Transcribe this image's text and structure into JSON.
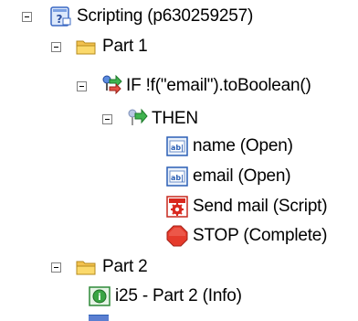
{
  "tree": {
    "root": {
      "label": "Scripting (p630259257)",
      "icon": "script-icon"
    },
    "part1": {
      "label": "Part 1",
      "icon": "folder-icon"
    },
    "if_node": {
      "label": "IF !f(\"email\").toBoolean()",
      "icon": "if-branch-icon"
    },
    "then_node": {
      "label": "THEN",
      "icon": "then-branch-icon"
    },
    "name_field": {
      "label": "name (Open)",
      "icon": "text-field-icon"
    },
    "email_field": {
      "label": "email (Open)",
      "icon": "text-field-icon"
    },
    "send_mail": {
      "label": "Send mail (Script)",
      "icon": "gear-script-icon"
    },
    "stop": {
      "label": "STOP (Complete)",
      "icon": "stop-icon"
    },
    "part2": {
      "label": "Part 2",
      "icon": "folder-icon"
    },
    "info": {
      "label": "i25 - Part 2 (Info)",
      "icon": "info-icon"
    }
  },
  "colors": {
    "folder": "#f5c542",
    "stop": "#e53b2c",
    "field_border": "#2b5fb5",
    "info": "#3aa544",
    "gear_bg": "#d9281e"
  }
}
